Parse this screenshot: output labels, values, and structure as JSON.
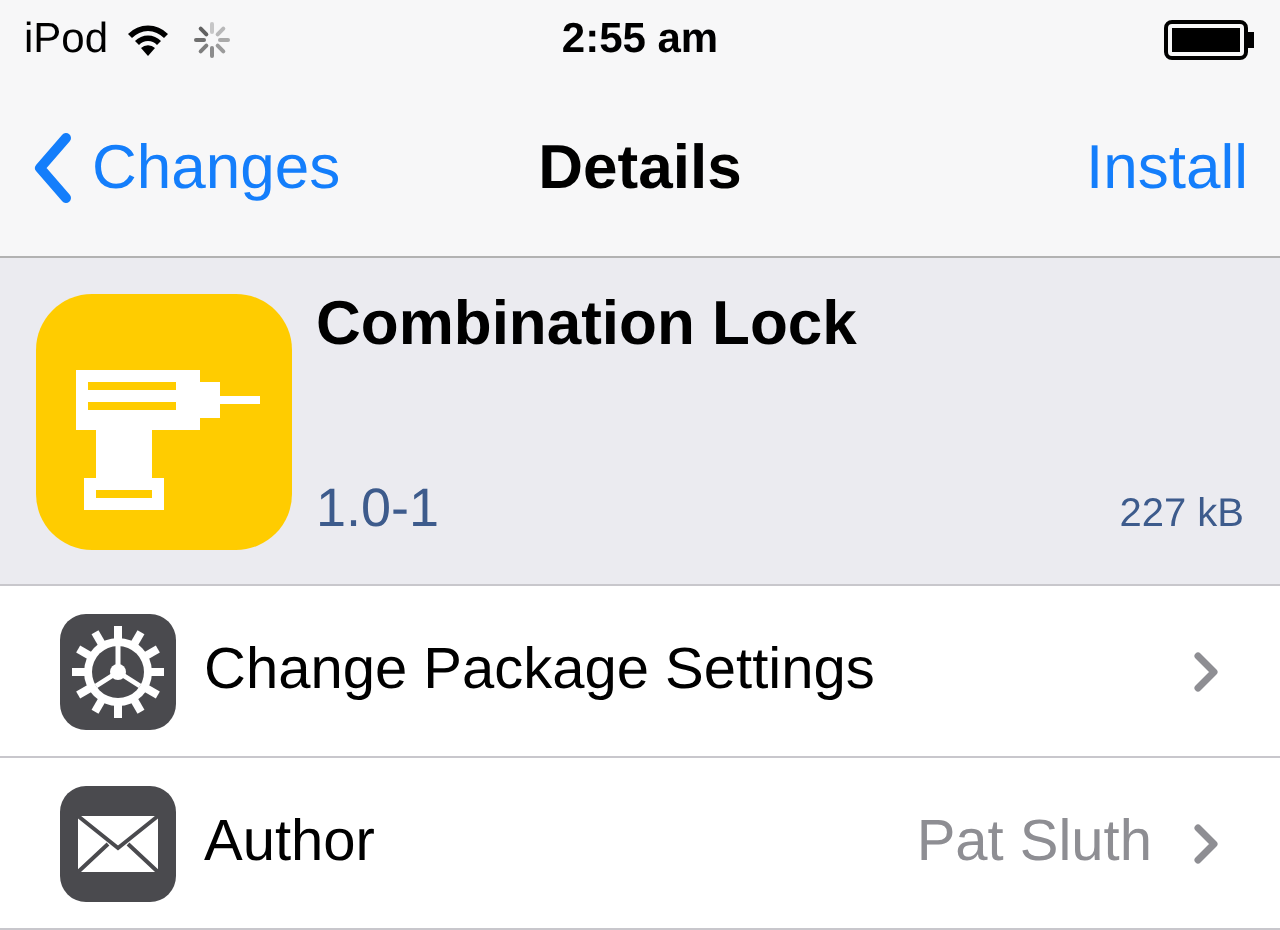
{
  "status_bar": {
    "carrier": "iPod",
    "time": "2:55 am",
    "loading": true
  },
  "nav": {
    "back": "Changes",
    "title": "Details",
    "action": "Install"
  },
  "package": {
    "name": "Combination Lock",
    "version": "1.0-1",
    "size": "227 kB"
  },
  "rows": [
    {
      "kind": "settings",
      "label": "Change Package Settings"
    },
    {
      "kind": "author",
      "label": "Author",
      "value": "Pat Sluth"
    }
  ]
}
